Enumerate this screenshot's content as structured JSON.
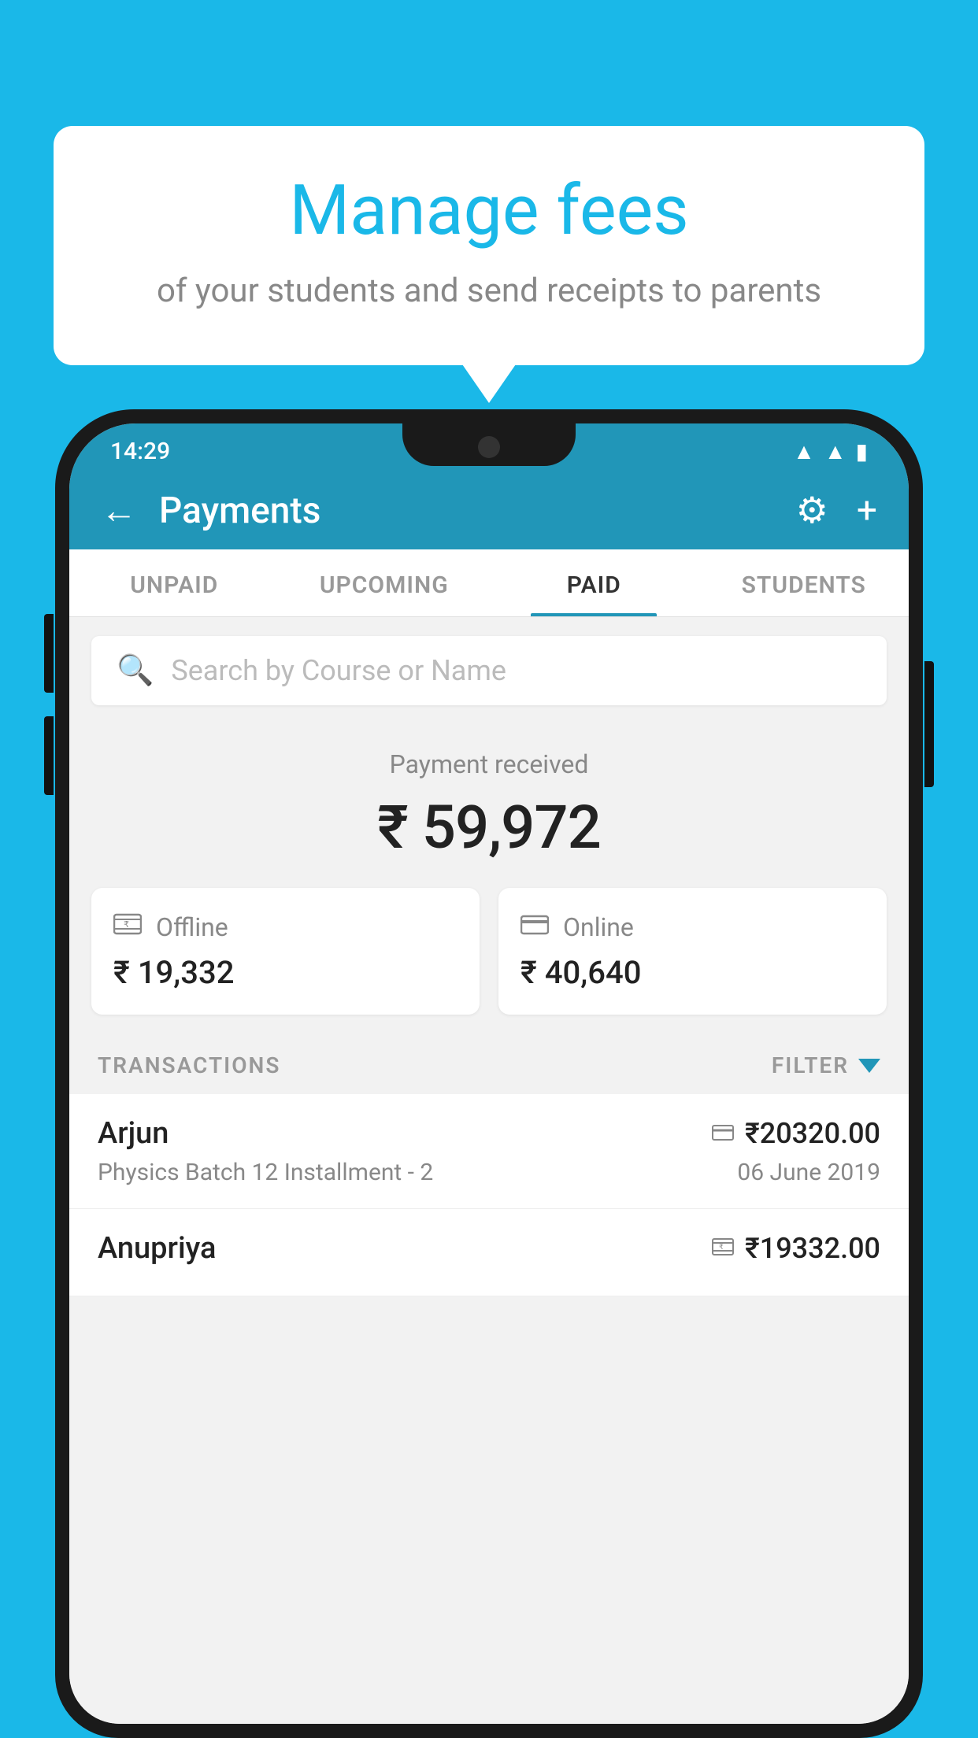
{
  "background_color": "#1ab8e8",
  "speech_bubble": {
    "title": "Manage fees",
    "subtitle": "of your students and send receipts to parents"
  },
  "status_bar": {
    "time": "14:29",
    "wifi_icon": "▲",
    "signal_icon": "▲",
    "battery_icon": "▮"
  },
  "top_bar": {
    "back_label": "←",
    "title": "Payments",
    "gear_icon": "⚙",
    "plus_icon": "+"
  },
  "tabs": [
    {
      "label": "UNPAID",
      "active": false
    },
    {
      "label": "UPCOMING",
      "active": false
    },
    {
      "label": "PAID",
      "active": true
    },
    {
      "label": "STUDENTS",
      "active": false
    }
  ],
  "search": {
    "placeholder": "Search by Course or Name"
  },
  "payment_summary": {
    "label": "Payment received",
    "amount": "₹ 59,972"
  },
  "payment_cards": [
    {
      "label": "Offline",
      "amount": "₹ 19,332",
      "icon": "rupee"
    },
    {
      "label": "Online",
      "amount": "₹ 40,640",
      "icon": "card"
    }
  ],
  "transactions_section": {
    "label": "TRANSACTIONS",
    "filter_label": "FILTER"
  },
  "transactions": [
    {
      "name": "Arjun",
      "course": "Physics Batch 12 Installment - 2",
      "amount": "₹20320.00",
      "date": "06 June 2019",
      "icon": "card"
    },
    {
      "name": "Anupriya",
      "course": "",
      "amount": "₹19332.00",
      "date": "",
      "icon": "rupee"
    }
  ]
}
